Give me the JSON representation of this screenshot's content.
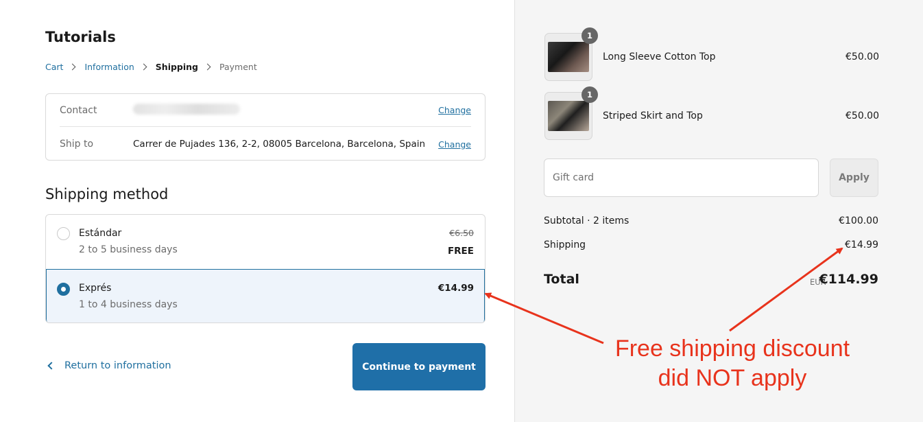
{
  "store": {
    "title": "Tutorials"
  },
  "breadcrumb": {
    "cart": "Cart",
    "information": "Information",
    "shipping": "Shipping",
    "payment": "Payment"
  },
  "review": {
    "contact_label": "Contact",
    "ship_to_label": "Ship to",
    "ship_to_value": "Carrer de Pujades 136, 2-2, 08005 Barcelona, Barcelona, Spain",
    "change_label": "Change"
  },
  "shipping_method": {
    "title": "Shipping method",
    "options": [
      {
        "name": "Estándar",
        "eta": "2 to 5 business days",
        "old_price": "€6.50",
        "price": "FREE",
        "selected": false
      },
      {
        "name": "Exprés",
        "eta": "1 to 4 business days",
        "price": "€14.99",
        "selected": true
      }
    ]
  },
  "footer": {
    "return_label": "Return to information",
    "continue_label": "Continue to payment"
  },
  "order": {
    "items": [
      {
        "name": "Long Sleeve Cotton Top",
        "price": "€50.00",
        "quantity": "1"
      },
      {
        "name": "Striped Skirt and Top",
        "price": "€50.00",
        "quantity": "1"
      }
    ],
    "gift_card_placeholder": "Gift card",
    "apply_label": "Apply",
    "subtotal_label": "Subtotal · 2 items",
    "subtotal_value": "€100.00",
    "shipping_label": "Shipping",
    "shipping_value": "€14.99",
    "total_label": "Total",
    "total_currency": "EUR",
    "total_value": "€114.99"
  },
  "annotation": {
    "line1": "Free shipping discount",
    "line2": "did NOT apply",
    "color": "#e8331c"
  },
  "colors": {
    "accent": "#1f6fa8",
    "link": "#1f6f9f",
    "selected_bg": "#eef4fb",
    "summary_bg": "#f5f5f5"
  }
}
